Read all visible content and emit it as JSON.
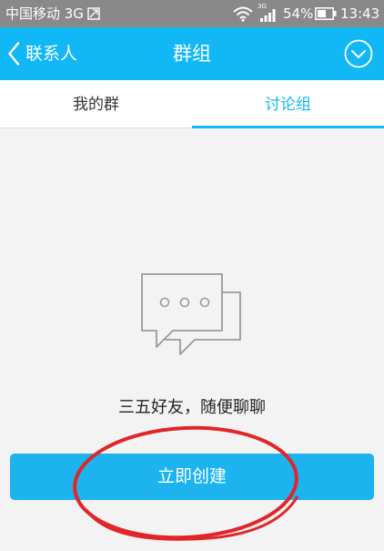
{
  "status_bar": {
    "carrier": "中国移动 3G",
    "network": "3G",
    "battery": "54%",
    "time": "13:43",
    "icons": [
      "sim-icon",
      "wifi-icon",
      "signal-icon",
      "battery-icon"
    ]
  },
  "nav": {
    "back_label": "联系人",
    "title": "群组",
    "menu_icon": "chevron-down-circle-icon"
  },
  "tabs": [
    {
      "label": "我的群",
      "selected": false
    },
    {
      "label": "讨论组",
      "selected": true
    }
  ],
  "empty_state": {
    "icon": "chat-bubbles-icon",
    "message": "三五好友，随便聊聊",
    "button_label": "立即创建"
  },
  "colors": {
    "accent": "#12b7f5",
    "button": "#1cb3ee",
    "status_bar": "#898989",
    "annotation": "#e0262a"
  }
}
